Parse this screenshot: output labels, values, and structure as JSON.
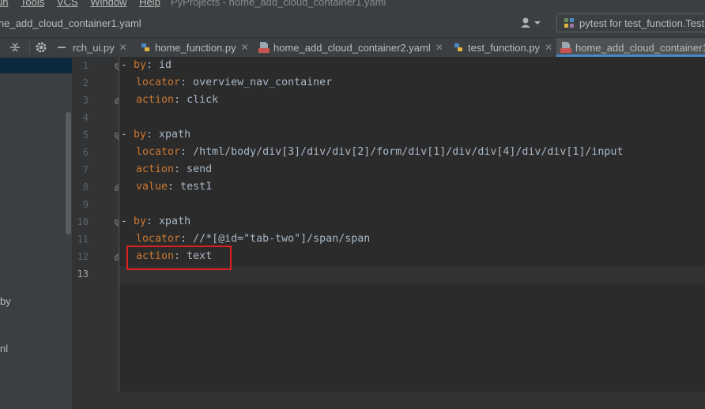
{
  "menubar": {
    "items": [
      "un",
      "Tools",
      "VCS",
      "Window",
      "Help"
    ],
    "project_title": "PyProjects - home_add_cloud_container1.yaml"
  },
  "navbar": {
    "breadcrumb": "ne_add_cloud_container1.yaml",
    "run_config": "pytest for test_function.Test"
  },
  "tabs": [
    {
      "label": "rch_ui.py",
      "type": "py",
      "active": false
    },
    {
      "label": "home_function.py",
      "type": "py",
      "active": false
    },
    {
      "label": "home_add_cloud_container2.yaml",
      "type": "yaml",
      "active": false
    },
    {
      "label": "test_function.py",
      "type": "py",
      "active": false
    },
    {
      "label": "home_add_cloud_container1",
      "type": "yaml",
      "active": true
    }
  ],
  "project_panel": {
    "fragments": [
      "by",
      "nl"
    ]
  },
  "editor": {
    "current_line": 13,
    "lines": [
      {
        "n": "1",
        "dash": "- ",
        "key": "by",
        "value": "id"
      },
      {
        "n": "2",
        "dash": "  ",
        "key": "locator",
        "value": "overview_nav_container"
      },
      {
        "n": "3",
        "dash": "  ",
        "key": "action",
        "value": "click"
      },
      {
        "n": "4",
        "dash": "",
        "key": "",
        "value": ""
      },
      {
        "n": "5",
        "dash": "- ",
        "key": "by",
        "value": "xpath"
      },
      {
        "n": "6",
        "dash": "  ",
        "key": "locator",
        "value": "/html/body/div[3]/div/div[2]/form/div[1]/div/div[4]/div/div[1]/input"
      },
      {
        "n": "7",
        "dash": "  ",
        "key": "action",
        "value": "send"
      },
      {
        "n": "8",
        "dash": "  ",
        "key": "value",
        "value": "test1"
      },
      {
        "n": "9",
        "dash": "",
        "key": "",
        "value": ""
      },
      {
        "n": "10",
        "dash": "- ",
        "key": "by",
        "value": "xpath"
      },
      {
        "n": "11",
        "dash": "  ",
        "key": "locator",
        "value": "//*[@id=\"tab-two\"]/span/span"
      },
      {
        "n": "12",
        "dash": "  ",
        "key": "action",
        "value": "text"
      },
      {
        "n": "13",
        "dash": "",
        "key": "",
        "value": ""
      }
    ]
  },
  "annotation": {
    "color": "#e02020",
    "target_line": 12
  }
}
